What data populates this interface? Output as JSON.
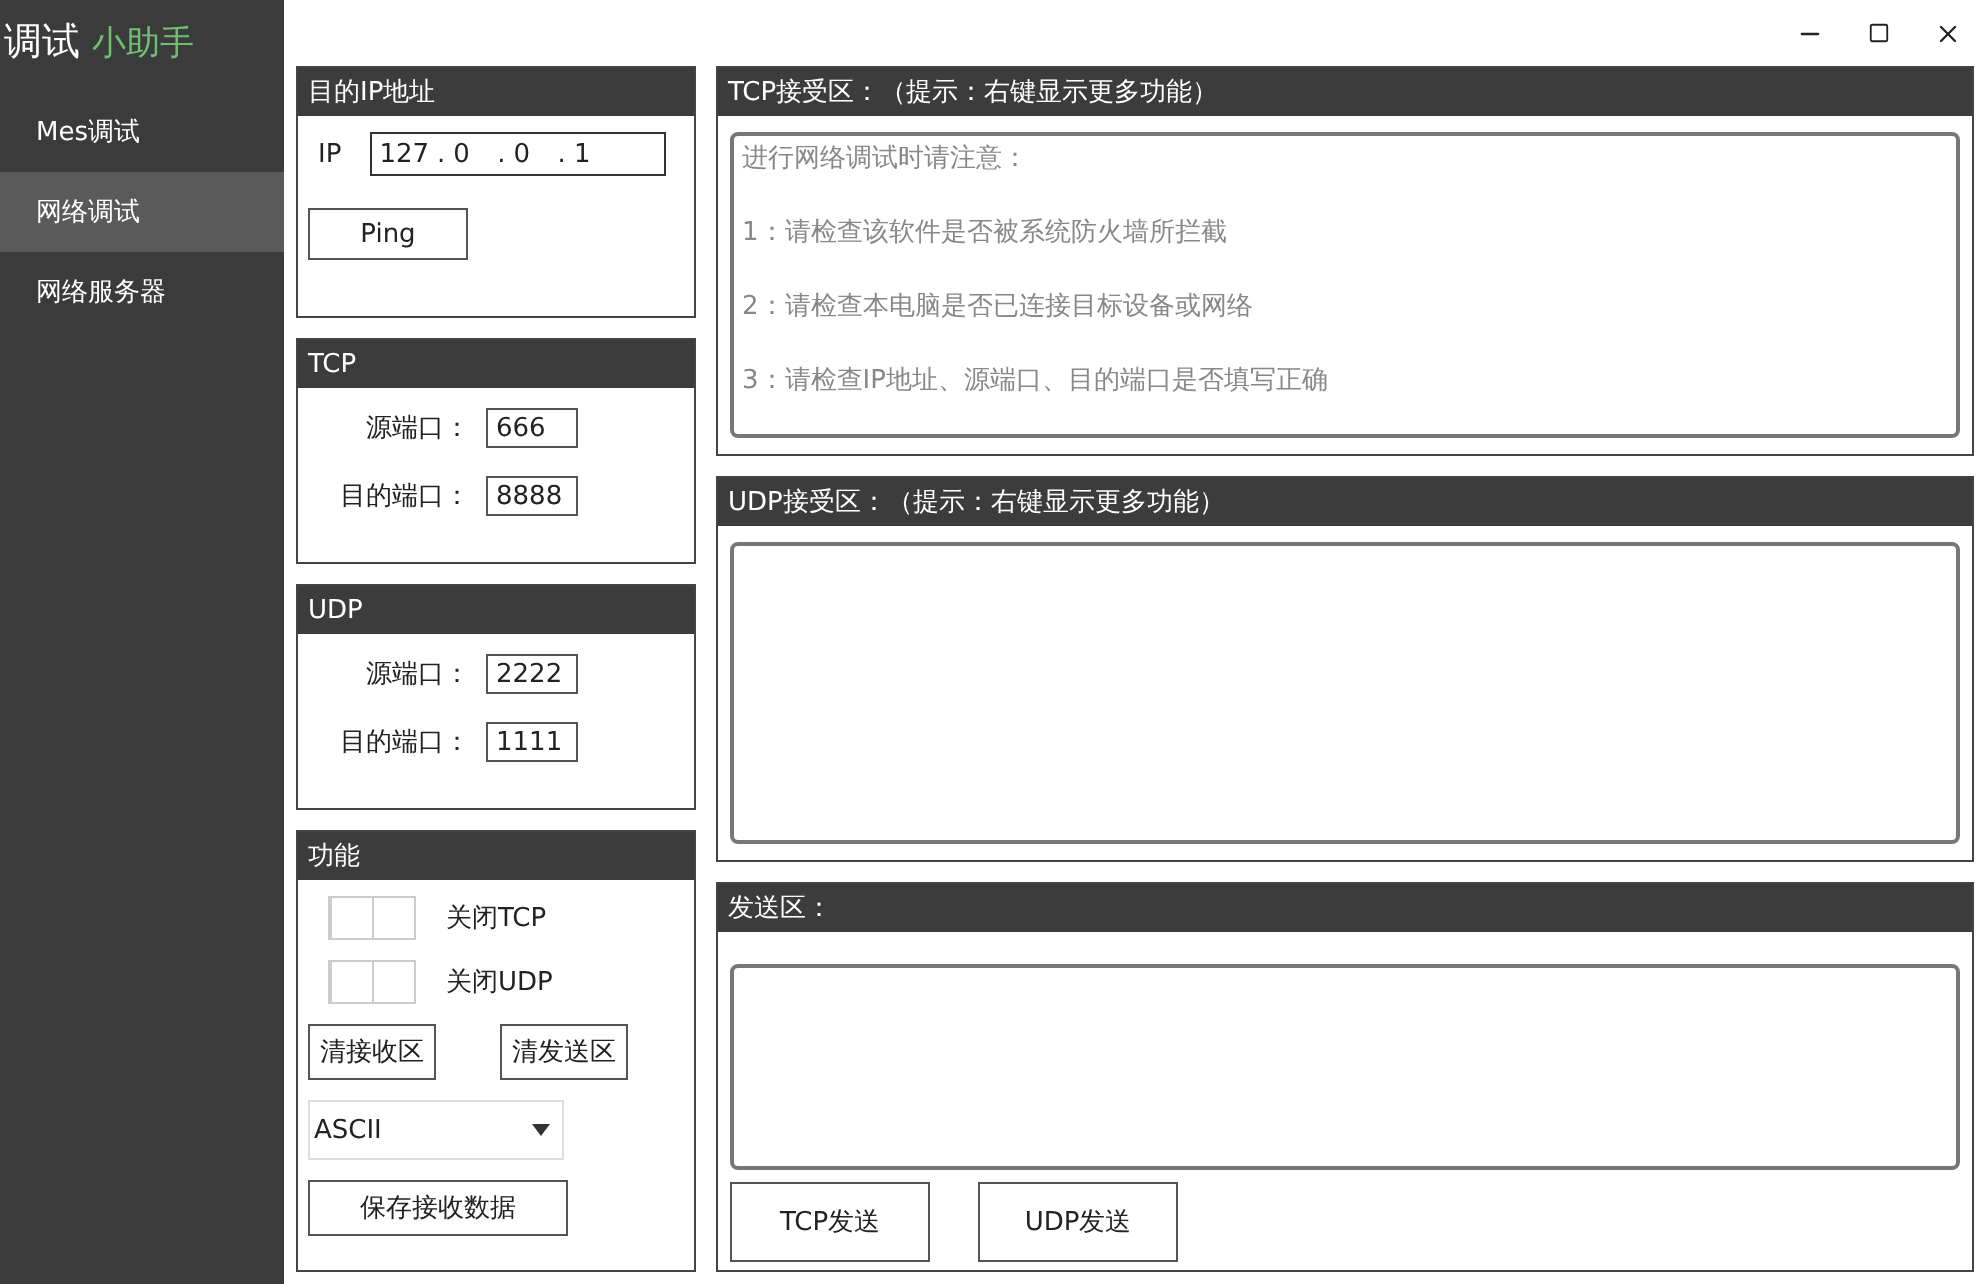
{
  "app_title": {
    "main": "调试",
    "accent": "小助手"
  },
  "sidebar": {
    "items": [
      {
        "label": "Mes调试",
        "selected": false
      },
      {
        "label": "网络调试",
        "selected": true
      },
      {
        "label": "网络服务器",
        "selected": false
      }
    ]
  },
  "ip_panel": {
    "title": "目的IP地址",
    "label": "IP",
    "octets": [
      "127",
      "0",
      "0",
      "1"
    ],
    "separator": ".",
    "button": "Ping"
  },
  "tcp_panel": {
    "title": "TCP",
    "fields": [
      {
        "label": "源端口：",
        "value": "666"
      },
      {
        "label": "目的端口：",
        "value": "8888"
      }
    ]
  },
  "udp_panel": {
    "title": "UDP",
    "fields": [
      {
        "label": "源端口：",
        "value": "2222"
      },
      {
        "label": "目的端口：",
        "value": "1111"
      }
    ]
  },
  "function_panel": {
    "title": "功能",
    "toggles": [
      {
        "label": "关闭TCP",
        "on": false
      },
      {
        "label": "关闭UDP",
        "on": false
      }
    ],
    "clear_buttons": [
      "清接收区",
      "清发送区"
    ],
    "encoding": "ASCII",
    "save_button": "保存接收数据"
  },
  "tcp_receive": {
    "title": "TCP接受区：（提示：右键显示更多功能）",
    "lines": [
      "进行网络调试时请注意：",
      "1：请检查该软件是否被系统防火墙所拦截",
      "2：请检查本电脑是否已连接目标设备或网络",
      "3：请检查IP地址、源端口、目的端口是否填写正确"
    ]
  },
  "udp_receive": {
    "title": "UDP接受区：（提示：右键显示更多功能）"
  },
  "send_area": {
    "title": "发送区：",
    "buttons": [
      "TCP发送",
      "UDP发送"
    ]
  }
}
